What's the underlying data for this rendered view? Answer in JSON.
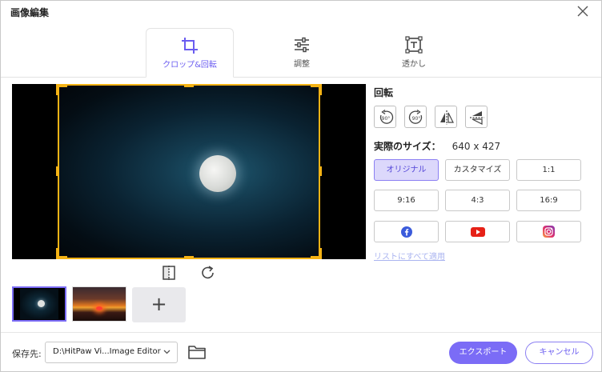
{
  "window": {
    "title": "画像編集"
  },
  "tabs": [
    {
      "label": "クロップ&回転",
      "icon": "crop-icon",
      "active": true
    },
    {
      "label": "調整",
      "icon": "sliders-icon",
      "active": false
    },
    {
      "label": "透かし",
      "icon": "watermark-icon",
      "active": false
    }
  ],
  "right_panel": {
    "rotate_label": "回転",
    "rotate_buttons": [
      {
        "name": "rotate-left-90",
        "icon": "rotate-left-90-icon",
        "text": "90°"
      },
      {
        "name": "rotate-right-90",
        "icon": "rotate-right-90-icon",
        "text": "90°"
      },
      {
        "name": "flip-horizontal",
        "icon": "flip-horizontal-icon"
      },
      {
        "name": "flip-vertical",
        "icon": "flip-vertical-icon"
      }
    ],
    "size_label": "実際のサイズ：",
    "size_value": "640 x 427",
    "ratios": [
      {
        "label": "オリジナル",
        "active": true
      },
      {
        "label": "カスタマイズ",
        "active": false
      },
      {
        "label": "1:1",
        "active": false
      },
      {
        "label": "9:16",
        "active": false
      },
      {
        "label": "4:3",
        "active": false
      },
      {
        "label": "16:9",
        "active": false
      }
    ],
    "social": [
      "facebook-icon",
      "youtube-icon",
      "instagram-icon"
    ],
    "apply_all": "リストにすべて適用"
  },
  "footer": {
    "save_label": "保存先:",
    "path": "D:\\HitPaw Vi...Image Editor",
    "export_label": "エクスポート",
    "cancel_label": "キャンセル"
  },
  "colors": {
    "accent": "#7b6cf6",
    "crop": "#f5b315"
  }
}
